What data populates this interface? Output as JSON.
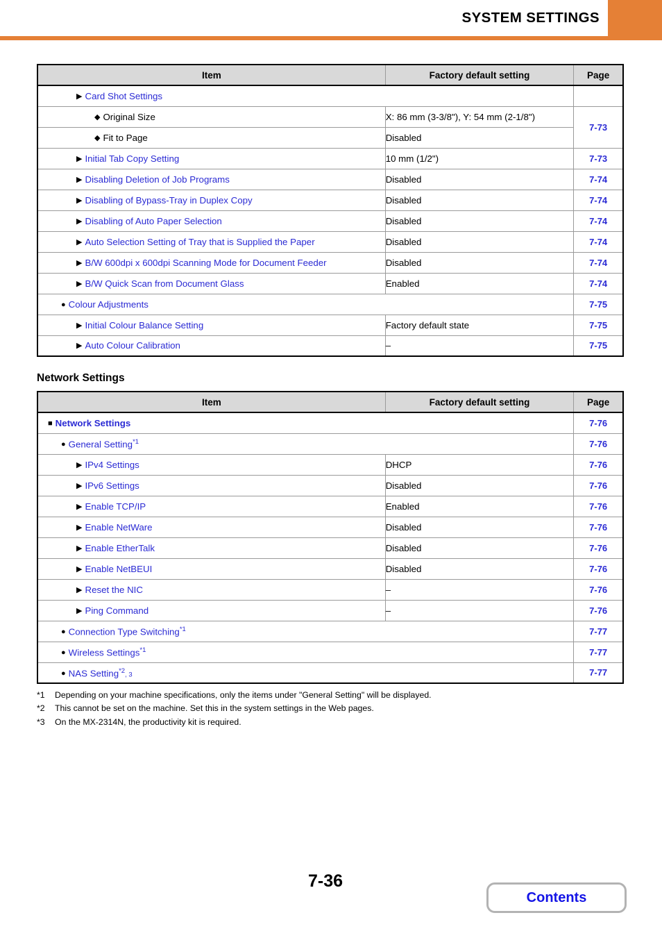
{
  "header": {
    "title": "SYSTEM SETTINGS",
    "accent_color": "#e58036"
  },
  "link_color": "#2b2bd4",
  "table_header": {
    "item": "Item",
    "value": "Factory default setting",
    "page": "Page"
  },
  "table1": {
    "rows": [
      {
        "bullet": "▶",
        "level": 2,
        "label": "Card Shot Settings",
        "link": true,
        "value": null,
        "merged_item_value": true,
        "page": null
      },
      {
        "bullet": "◆",
        "level": 3,
        "label": "Original Size",
        "link": false,
        "value": "X: 86 mm (3-3/8\"), Y: 54 mm (2-1/8\")",
        "page": "7-73",
        "page_rowspan": 2
      },
      {
        "bullet": "◆",
        "level": 3,
        "label": "Fit to Page",
        "link": false,
        "value": "Disabled",
        "page": null
      },
      {
        "bullet": "▶",
        "level": 2,
        "label": "Initial Tab Copy Setting",
        "link": true,
        "value": "10 mm (1/2\")",
        "page": "7-73"
      },
      {
        "bullet": "▶",
        "level": 2,
        "label": "Disabling Deletion of Job Programs",
        "link": true,
        "value": "Disabled",
        "page": "7-74"
      },
      {
        "bullet": "▶",
        "level": 2,
        "label": "Disabling of Bypass-Tray in Duplex Copy",
        "link": true,
        "value": "Disabled",
        "page": "7-74"
      },
      {
        "bullet": "▶",
        "level": 2,
        "label": "Disabling of Auto Paper Selection",
        "link": true,
        "value": "Disabled",
        "page": "7-74"
      },
      {
        "bullet": "▶",
        "level": 2,
        "label": "Auto Selection Setting of Tray that is Supplied the Paper",
        "link": true,
        "value": "Disabled",
        "page": "7-74"
      },
      {
        "bullet": "▶",
        "level": 2,
        "label": "B/W 600dpi x 600dpi Scanning Mode for Document Feeder",
        "link": true,
        "value": "Disabled",
        "page": "7-74"
      },
      {
        "bullet": "▶",
        "level": 2,
        "label": "B/W Quick Scan from Document Glass",
        "link": true,
        "value": "Enabled",
        "page": "7-74"
      },
      {
        "bullet": "●",
        "level": 1,
        "label": "Colour Adjustments",
        "link": true,
        "value": null,
        "merged_item_value": true,
        "page": "7-75"
      },
      {
        "bullet": "▶",
        "level": 2,
        "label": "Initial Colour Balance Setting",
        "link": true,
        "value": "Factory default state",
        "page": "7-75"
      },
      {
        "bullet": "▶",
        "level": 2,
        "label": "Auto Colour Calibration",
        "link": true,
        "value": "–",
        "page": "7-75"
      }
    ]
  },
  "section2": {
    "title": "Network Settings"
  },
  "table2": {
    "rows": [
      {
        "bullet": "■",
        "level": 0,
        "label": "Network Settings",
        "link": true,
        "bold": true,
        "value": null,
        "merged_item_value": true,
        "page": "7-76"
      },
      {
        "bullet": "●",
        "level": 1,
        "label": "General Setting",
        "footnote": "*1",
        "link": true,
        "value": null,
        "merged_item_value": true,
        "page": "7-76"
      },
      {
        "bullet": "▶",
        "level": 2,
        "label": "IPv4 Settings",
        "link": true,
        "value": "DHCP",
        "page": "7-76"
      },
      {
        "bullet": "▶",
        "level": 2,
        "label": "IPv6 Settings",
        "link": true,
        "value": "Disabled",
        "page": "7-76"
      },
      {
        "bullet": "▶",
        "level": 2,
        "label": "Enable TCP/IP",
        "link": true,
        "value": "Enabled",
        "page": "7-76"
      },
      {
        "bullet": "▶",
        "level": 2,
        "label": "Enable NetWare",
        "link": true,
        "value": "Disabled",
        "page": "7-76"
      },
      {
        "bullet": "▶",
        "level": 2,
        "label": "Enable EtherTalk",
        "link": true,
        "value": "Disabled",
        "page": "7-76"
      },
      {
        "bullet": "▶",
        "level": 2,
        "label": "Enable NetBEUI",
        "link": true,
        "value": "Disabled",
        "page": "7-76"
      },
      {
        "bullet": "▶",
        "level": 2,
        "label": "Reset the NIC",
        "link": true,
        "value": "–",
        "page": "7-76"
      },
      {
        "bullet": "▶",
        "level": 2,
        "label": "Ping Command",
        "link": true,
        "value": "–",
        "page": "7-76"
      },
      {
        "bullet": "●",
        "level": 1,
        "label": "Connection Type Switching",
        "footnote": "*1",
        "link": true,
        "value": null,
        "merged_item_value": true,
        "page": "7-77"
      },
      {
        "bullet": "●",
        "level": 1,
        "label": "Wireless Settings",
        "footnote": "*1",
        "link": true,
        "value": null,
        "merged_item_value": true,
        "page": "7-77"
      },
      {
        "bullet": "●",
        "level": 1,
        "label": "NAS Setting",
        "footnote": "*2",
        "footnote2": ", 3",
        "link": true,
        "value": null,
        "merged_item_value": true,
        "page": "7-77"
      }
    ]
  },
  "footnotes": [
    {
      "mark": "*1",
      "text": "Depending on your machine specifications, only the items under \"General Setting\" will be displayed."
    },
    {
      "mark": "*2",
      "text": "This cannot be set on the machine. Set this in the system settings in the Web pages."
    },
    {
      "mark": "*3",
      "text": "On the MX-2314N, the productivity kit is required."
    }
  ],
  "footer": {
    "page_number": "7-36",
    "contents_label": "Contents"
  }
}
